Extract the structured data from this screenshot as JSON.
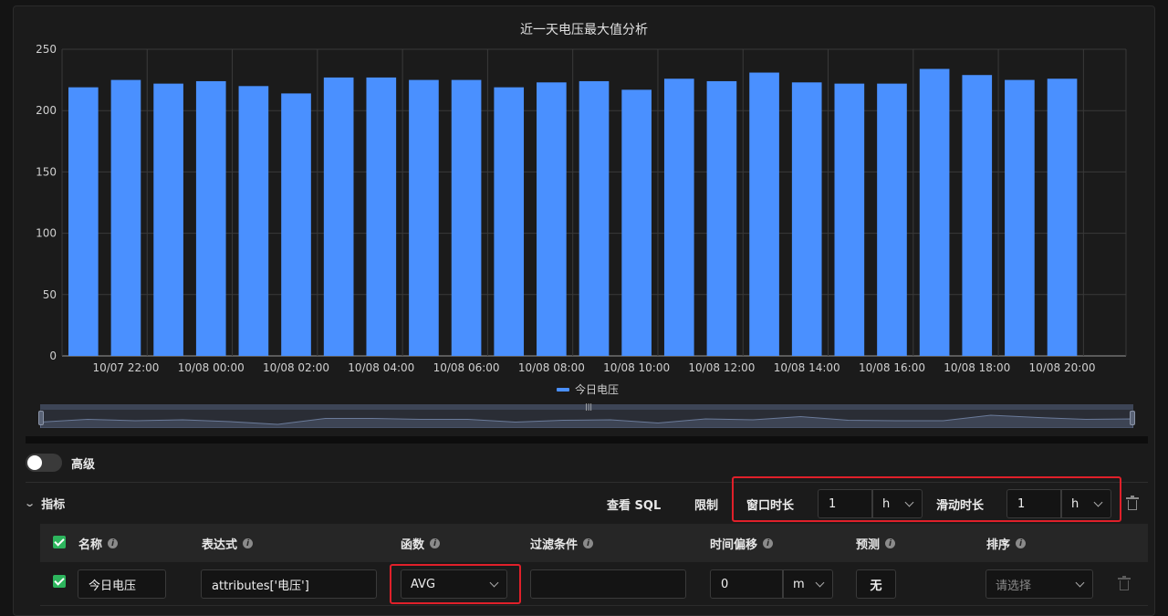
{
  "chart_data": {
    "type": "bar",
    "title": "近一天电压最大值分析",
    "series": [
      {
        "name": "今日电压",
        "values": [
          219,
          225,
          222,
          224,
          220,
          214,
          227,
          227,
          225,
          225,
          219,
          223,
          224,
          217,
          226,
          224,
          231,
          223,
          222,
          222,
          234,
          229,
          225,
          226
        ]
      }
    ],
    "x_tick_labels": [
      "10/07 22:00",
      "10/08 00:00",
      "10/08 02:00",
      "10/08 04:00",
      "10/08 06:00",
      "10/08 08:00",
      "10/08 10:00",
      "10/08 12:00",
      "10/08 14:00",
      "10/08 16:00",
      "10/08 18:00",
      "10/08 20:00"
    ],
    "y_ticks": [
      0,
      50,
      100,
      150,
      200,
      250
    ],
    "ylim": [
      0,
      250
    ],
    "grid": true,
    "legend": "bottom-center",
    "bar_color": "#4a90ff"
  },
  "advanced": {
    "label": "高级",
    "enabled": false
  },
  "metrics": {
    "section_label": "指标",
    "view_sql": "查看 SQL",
    "limit": "限制",
    "window_label": "窗口时长",
    "window_value": "1",
    "window_unit": "h",
    "slide_label": "滑动时长",
    "slide_value": "1",
    "slide_unit": "h"
  },
  "table": {
    "headers": {
      "name": "名称",
      "expression": "表达式",
      "function": "函数",
      "filter": "过滤条件",
      "time_offset": "时间偏移",
      "forecast": "预测",
      "sort": "排序"
    },
    "rows": [
      {
        "name": "今日电压",
        "expression": "attributes['电压']",
        "function": "AVG",
        "filter": "",
        "time_offset_value": "0",
        "time_offset_unit": "m",
        "forecast": "无",
        "sort_placeholder": "请选择"
      }
    ]
  },
  "colors": {
    "accent": "#4a90ff",
    "highlight": "#e0202a",
    "check": "#2db55d"
  }
}
